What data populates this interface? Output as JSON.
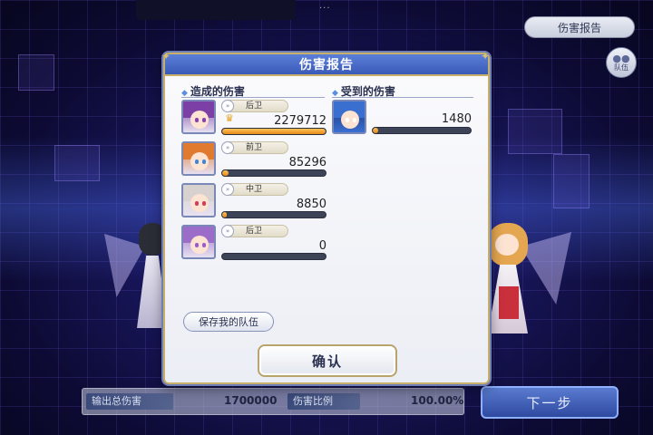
{
  "top_right": {
    "report_label": "伤害报告",
    "team_label": "队伍"
  },
  "dialog": {
    "title": "伤害报告",
    "dealt_title": "造成的伤害",
    "taken_title": "受到的伤害",
    "dealt": [
      {
        "position": "后卫",
        "value": "2279712",
        "mvp": true,
        "fill": 1.0,
        "hair_color": "#7b3fa6",
        "eye_color": "#8a3fb0"
      },
      {
        "position": "前卫",
        "value": "85296",
        "mvp": false,
        "fill": 0.06,
        "hair_color": "#e07a2e",
        "eye_color": "#3f86d8"
      },
      {
        "position": "中卫",
        "value": "8850",
        "mvp": false,
        "fill": 0.04,
        "hair_color": "#d7d2cf",
        "eye_color": "#d43c5c"
      },
      {
        "position": "后卫",
        "value": "0",
        "mvp": false,
        "fill": 0.0,
        "hair_color": "#9b6cc8",
        "eye_color": "#9b5ad0"
      }
    ],
    "taken": [
      {
        "value": "1480",
        "fill": 0.06,
        "hair_color": "#3a6fd0"
      }
    ],
    "save_team_label": "保存我的队伍",
    "confirm_label": "确认"
  },
  "bottom": {
    "total_damage_label": "输出总伤害",
    "total_damage_value": "1700000",
    "ratio_label": "伤害比例",
    "ratio_value": "100.00%",
    "next_label": "下一步"
  },
  "colors": {
    "accent_blue": "#3a5ab8",
    "gold": "#c8b06a",
    "bar_orange": "#e68a16"
  },
  "icons": {
    "mvp": "crown-icon",
    "position": "position-icon",
    "team": "team-icon"
  }
}
